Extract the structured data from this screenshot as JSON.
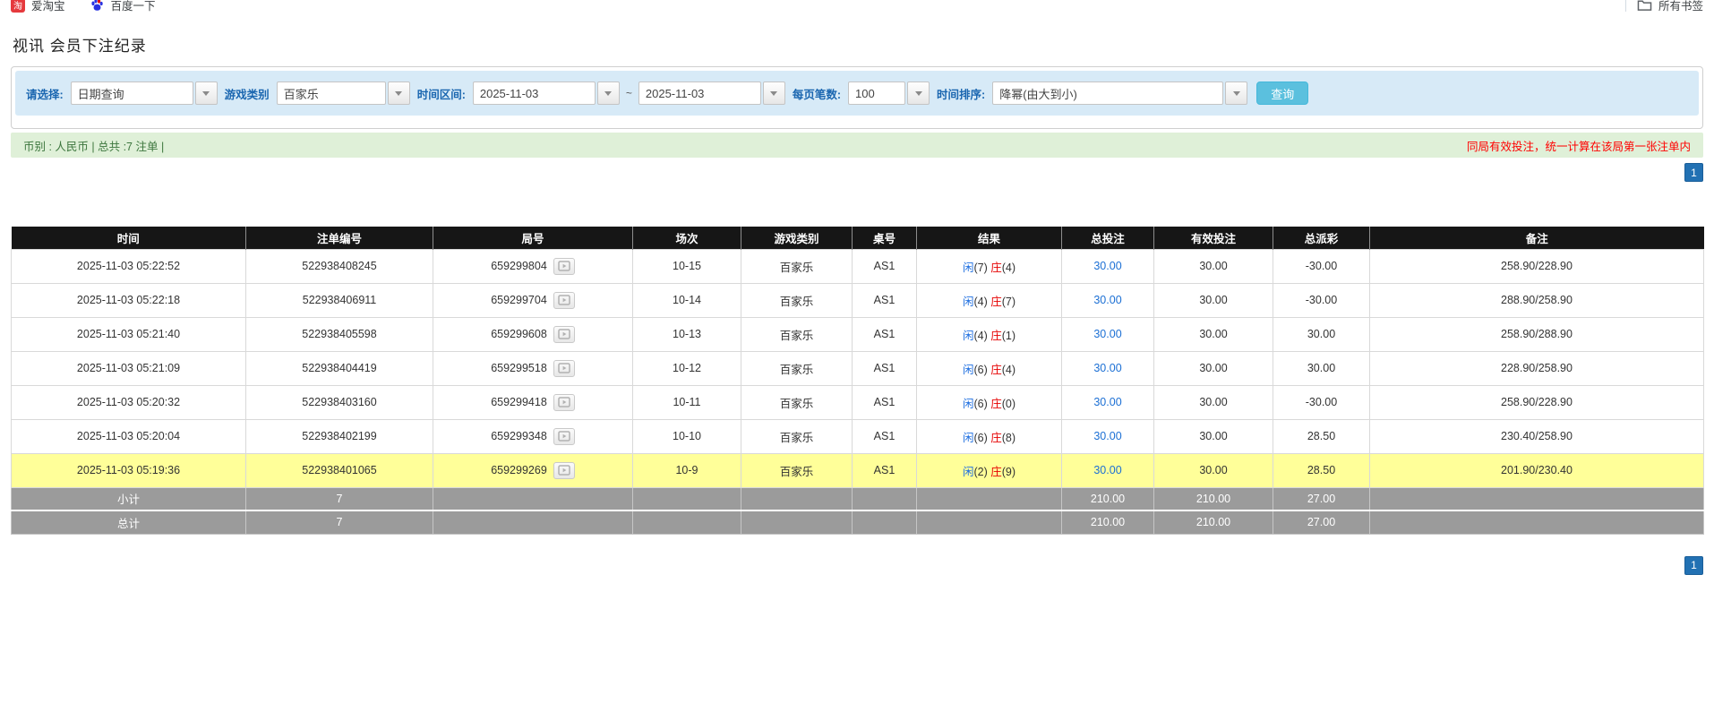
{
  "bookmarks_bar": {
    "items": [
      {
        "label": "爱淘宝",
        "icon": "taobao-icon",
        "icon_glyph": "淘",
        "icon_color": "#e5393d"
      },
      {
        "label": "百度一下",
        "icon": "baidu-paw-icon",
        "icon_color": "#2932e1"
      }
    ],
    "all_bookmarks_label": "所有书签"
  },
  "page": {
    "title": "视讯 会员下注纪录"
  },
  "filters": {
    "select_label": "请选择:",
    "select_value": "日期查询",
    "game_type_label": "游戏类别",
    "game_type_value": "百家乐",
    "time_range_label": "时间区间:",
    "date_from": "2025-11-03",
    "range_separator": "~",
    "date_to": "2025-11-03",
    "page_size_label": "每页笔数:",
    "page_size_value": "100",
    "sort_label": "时间排序:",
    "sort_value": "降幂(由大到小)",
    "search_button": "查询"
  },
  "summary": {
    "left_text": "币别 : 人民币 | 总共 :7 注单 |",
    "right_note": "同局有效投注，统一计算在该局第一张注单内"
  },
  "pagination": {
    "page": "1"
  },
  "table": {
    "headers": [
      "时间",
      "注单编号",
      "局号",
      "场次",
      "游戏类别",
      "桌号",
      "结果",
      "总投注",
      "有效投注",
      "总派彩",
      "备注"
    ],
    "rows": [
      {
        "time": "2025-11-03 05:22:52",
        "bet_id": "522938408245",
        "round_id": "659299804",
        "session": "10-15",
        "game": "百家乐",
        "table_no": "AS1",
        "result": {
          "player": "闲",
          "player_n": "(7)",
          "banker": "庄",
          "banker_n": "(4)"
        },
        "total_bet": "30.00",
        "valid_bet": "30.00",
        "payout": "-30.00",
        "remark": "258.90/228.90",
        "highlight": false
      },
      {
        "time": "2025-11-03 05:22:18",
        "bet_id": "522938406911",
        "round_id": "659299704",
        "session": "10-14",
        "game": "百家乐",
        "table_no": "AS1",
        "result": {
          "player": "闲",
          "player_n": "(4)",
          "banker": "庄",
          "banker_n": "(7)"
        },
        "total_bet": "30.00",
        "valid_bet": "30.00",
        "payout": "-30.00",
        "remark": "288.90/258.90",
        "highlight": false
      },
      {
        "time": "2025-11-03 05:21:40",
        "bet_id": "522938405598",
        "round_id": "659299608",
        "session": "10-13",
        "game": "百家乐",
        "table_no": "AS1",
        "result": {
          "player": "闲",
          "player_n": "(4)",
          "banker": "庄",
          "banker_n": "(1)"
        },
        "total_bet": "30.00",
        "valid_bet": "30.00",
        "payout": "30.00",
        "remark": "258.90/288.90",
        "highlight": false
      },
      {
        "time": "2025-11-03 05:21:09",
        "bet_id": "522938404419",
        "round_id": "659299518",
        "session": "10-12",
        "game": "百家乐",
        "table_no": "AS1",
        "result": {
          "player": "闲",
          "player_n": "(6)",
          "banker": "庄",
          "banker_n": "(4)"
        },
        "total_bet": "30.00",
        "valid_bet": "30.00",
        "payout": "30.00",
        "remark": "228.90/258.90",
        "highlight": false
      },
      {
        "time": "2025-11-03 05:20:32",
        "bet_id": "522938403160",
        "round_id": "659299418",
        "session": "10-11",
        "game": "百家乐",
        "table_no": "AS1",
        "result": {
          "player": "闲",
          "player_n": "(6)",
          "banker": "庄",
          "banker_n": "(0)"
        },
        "total_bet": "30.00",
        "valid_bet": "30.00",
        "payout": "-30.00",
        "remark": "258.90/228.90",
        "highlight": false
      },
      {
        "time": "2025-11-03 05:20:04",
        "bet_id": "522938402199",
        "round_id": "659299348",
        "session": "10-10",
        "game": "百家乐",
        "table_no": "AS1",
        "result": {
          "player": "闲",
          "player_n": "(6)",
          "banker": "庄",
          "banker_n": "(8)"
        },
        "total_bet": "30.00",
        "valid_bet": "30.00",
        "payout": "28.50",
        "remark": "230.40/258.90",
        "highlight": false
      },
      {
        "time": "2025-11-03 05:19:36",
        "bet_id": "522938401065",
        "round_id": "659299269",
        "session": "10-9",
        "game": "百家乐",
        "table_no": "AS1",
        "result": {
          "player": "闲",
          "player_n": "(2)",
          "banker": "庄",
          "banker_n": "(9)"
        },
        "total_bet": "30.00",
        "valid_bet": "30.00",
        "payout": "28.50",
        "remark": "201.90/230.40",
        "highlight": true
      }
    ],
    "subtotal": {
      "label": "小计",
      "count": "7",
      "total_bet": "210.00",
      "valid_bet": "210.00",
      "payout": "27.00"
    },
    "total": {
      "label": "总计",
      "count": "7",
      "total_bet": "210.00",
      "valid_bet": "210.00",
      "payout": "27.00"
    }
  },
  "colors": {
    "accent_blue_label": "#1a66b0",
    "search_button": "#5bc0de",
    "summary_bg": "#dff0d8",
    "summary_note_red": "#ff0000",
    "header_bg": "#161616",
    "highlight_row": "#ffff99",
    "footer_bg": "#9b9b9b",
    "player_blue": "#1f6fe0",
    "banker_red": "#e60000",
    "link_blue": "#1b6fd4",
    "pagination_blue": "#2271b3"
  }
}
